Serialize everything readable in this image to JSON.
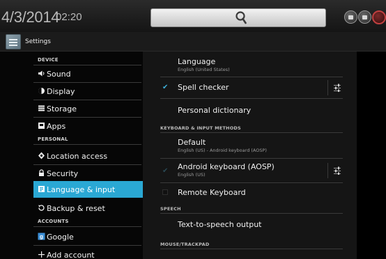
{
  "status_bar": {
    "date": "4/3/2014",
    "time": "02:20",
    "search_icon": "search-icon",
    "buttons": [
      "recent-apps-icon",
      "home-icon",
      "power-icon"
    ]
  },
  "action_bar": {
    "title": "Settings",
    "icon": "settings-app-icon"
  },
  "sidebar": {
    "sections": [
      {
        "header": "DEVICE"
      },
      {
        "header": "PERSONAL"
      },
      {
        "header": "ACCOUNTS"
      }
    ],
    "items": [
      {
        "label": "Sound",
        "icon": "sound-icon"
      },
      {
        "label": "Display",
        "icon": "display-icon"
      },
      {
        "label": "Storage",
        "icon": "storage-icon"
      },
      {
        "label": "Apps",
        "icon": "apps-icon"
      },
      {
        "label": "Location access",
        "icon": "location-icon"
      },
      {
        "label": "Security",
        "icon": "lock-icon"
      },
      {
        "label": "Language & input",
        "icon": "language-icon",
        "selected": true
      },
      {
        "label": "Backup & reset",
        "icon": "backup-icon"
      },
      {
        "label": "Google",
        "icon": "google-icon"
      },
      {
        "label": "Add account",
        "icon": "plus-icon"
      }
    ]
  },
  "main": {
    "language": {
      "title": "Language",
      "subtitle": "English (United States)"
    },
    "spell_checker": {
      "title": "Spell checker",
      "checked": true
    },
    "personal_dictionary": {
      "title": "Personal dictionary"
    },
    "section_keyboard": "KEYBOARD & INPUT METHODS",
    "default_keyboard": {
      "title": "Default",
      "subtitle": "English (US) - Android keyboard (AOSP)"
    },
    "android_keyboard": {
      "title": "Android keyboard (AOSP)",
      "subtitle": "English (US)",
      "checked": true
    },
    "remote_keyboard": {
      "title": "Remote Keyboard",
      "checked": false
    },
    "section_speech": "SPEECH",
    "tts_output": {
      "title": "Text-to-speech output"
    },
    "section_mouse": "MOUSE/TRACKPAD"
  },
  "colors": {
    "accent": "#2aa8d4",
    "check_active": "#3fb0d9",
    "check_dim": "#2a4a55",
    "statusbar_bg": "#1e1e1e",
    "pane_bg": "#151515"
  }
}
